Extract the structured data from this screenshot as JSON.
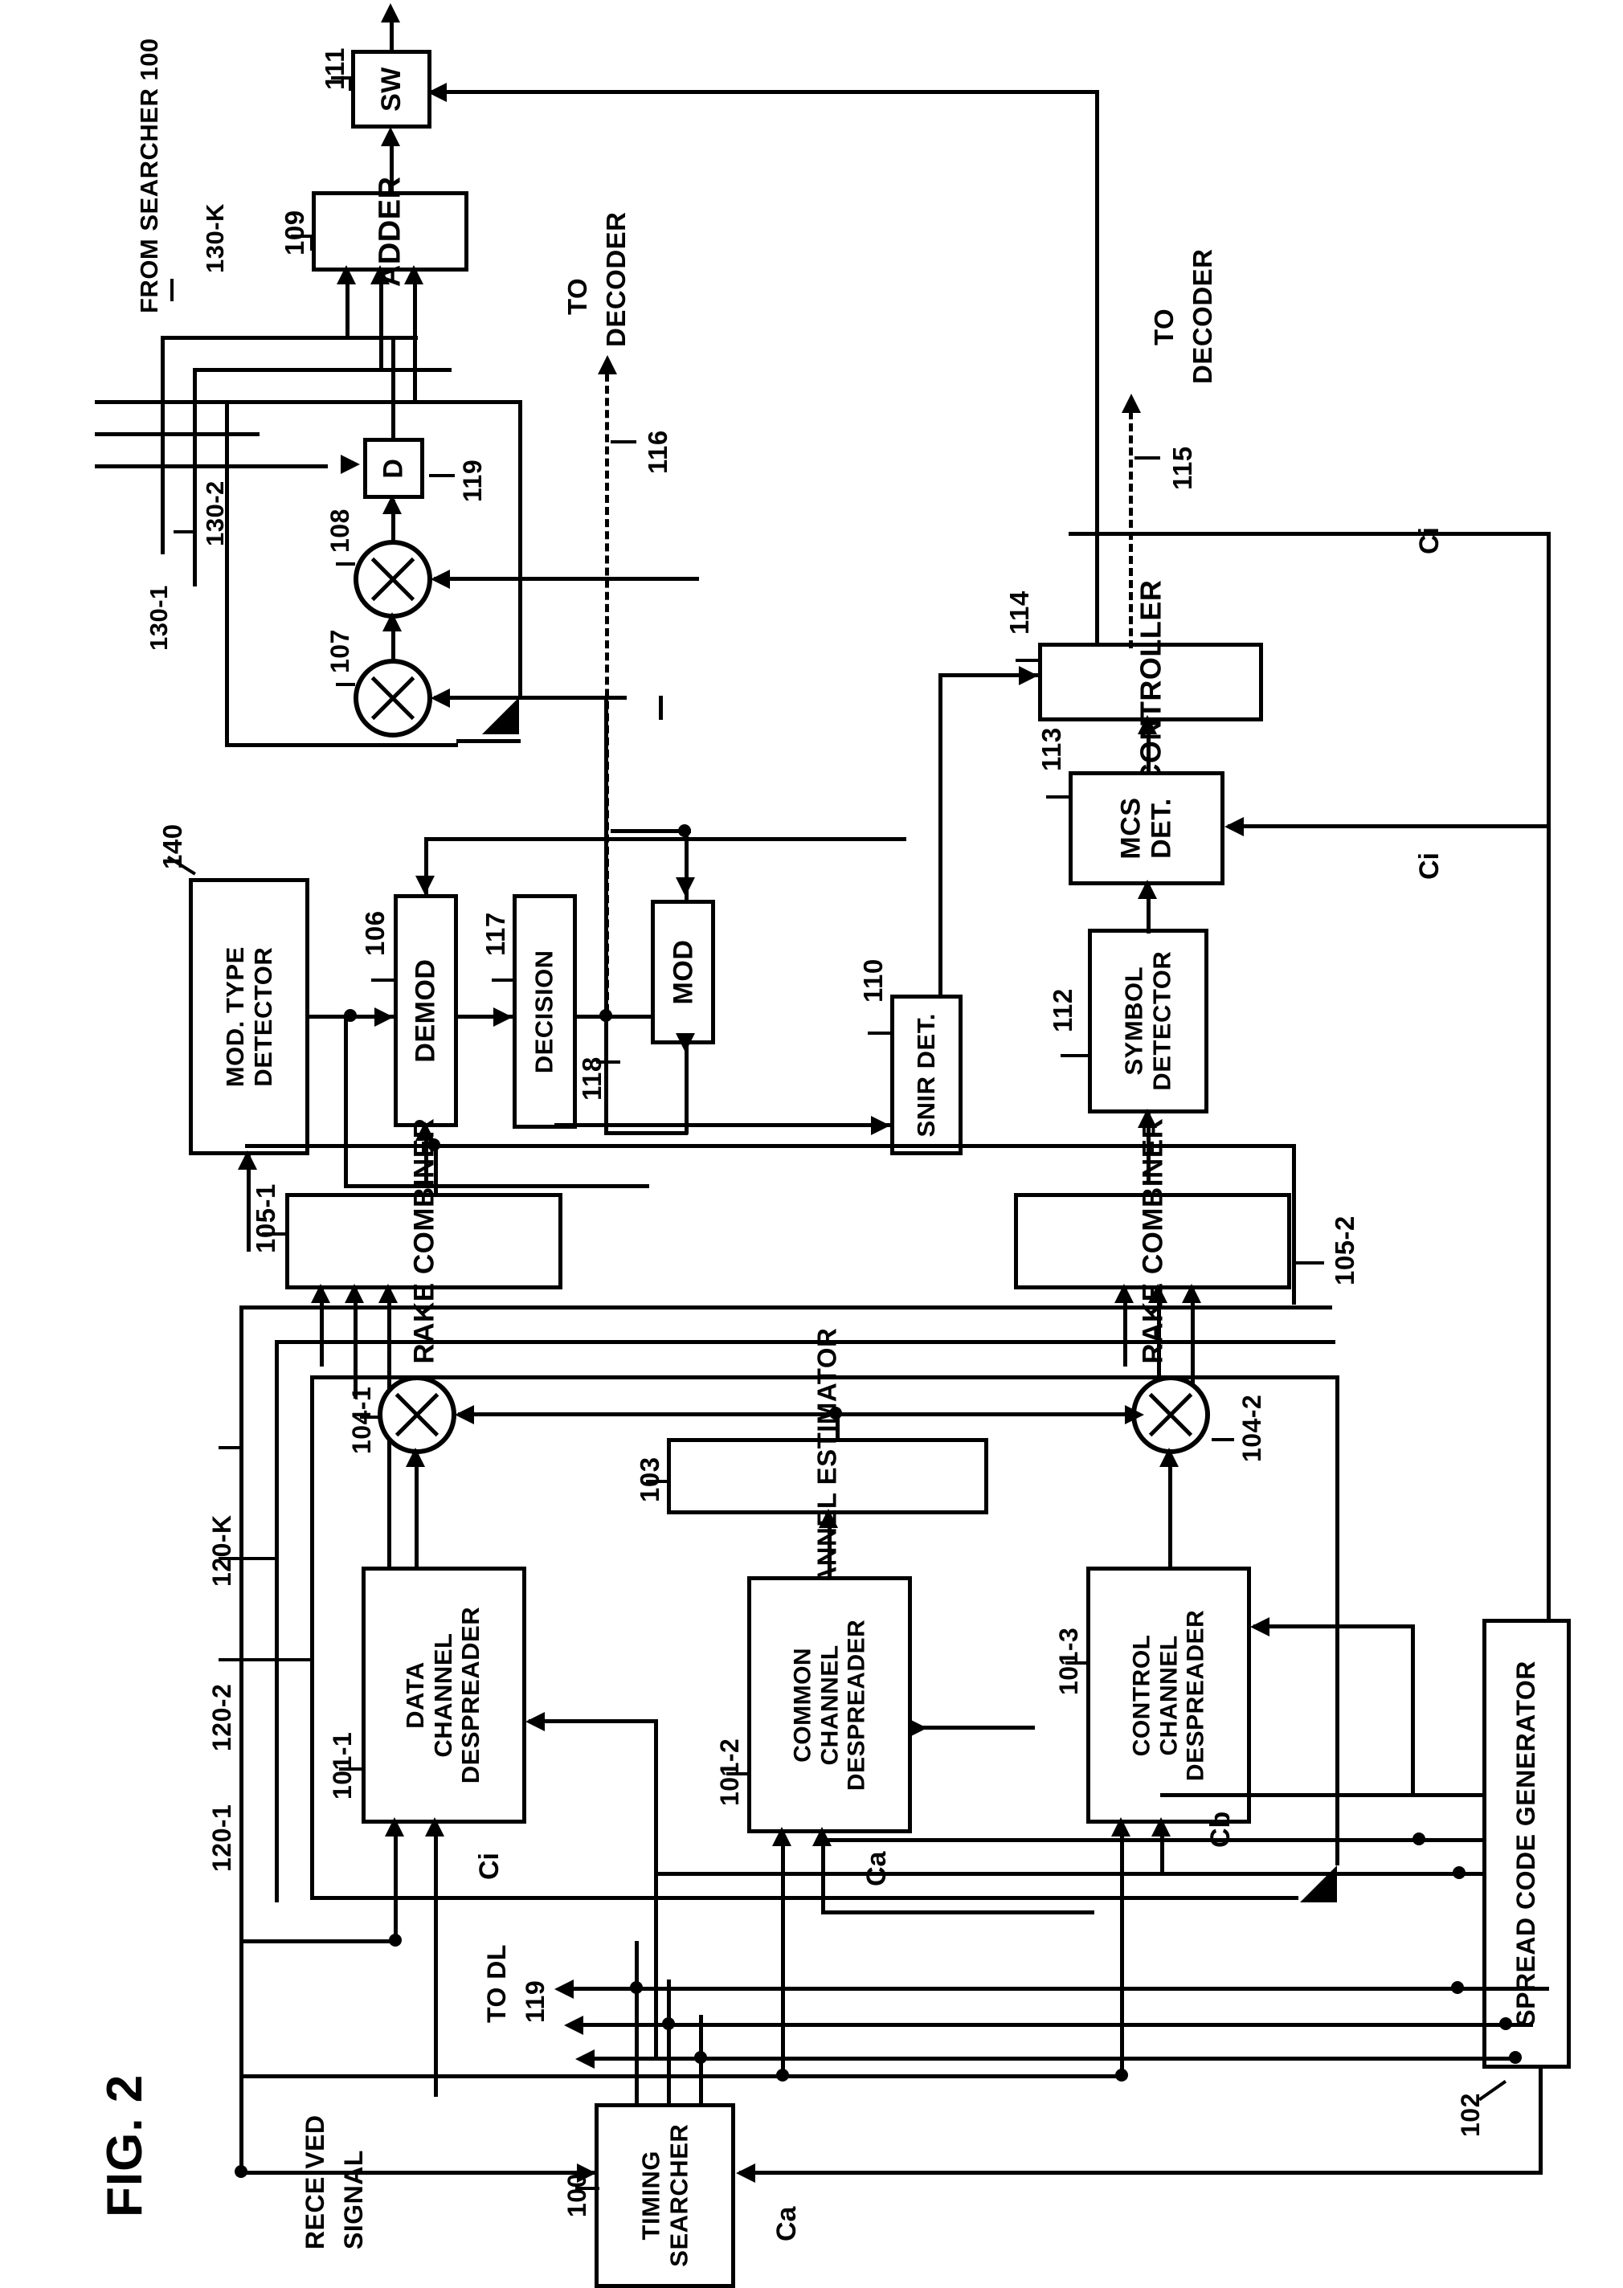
{
  "figure": {
    "title": "FIG. 2",
    "domain_note": "Patent block diagram of a CDMA rake receiver, drawn rotated 90 degrees"
  },
  "external_labels": {
    "from_searcher": "FROM SEARCHER 100",
    "received_signal": "RECEIVED\nSIGNAL",
    "received_signal_line1": "RECEIVED",
    "received_signal_line2": "SIGNAL",
    "to_decoder_top_line1": "TO",
    "to_decoder_top_line2": "DECODER",
    "to_decoder_mid_line1": "TO",
    "to_decoder_mid_line2": "DECODER",
    "to_dl_line1": "TO DL",
    "to_dl_line2": "119"
  },
  "blocks": [
    {
      "id": "sw",
      "ref": "111",
      "label": "SW"
    },
    {
      "id": "adder",
      "ref": "109",
      "label": "ADDER"
    },
    {
      "id": "delay",
      "ref": "119",
      "label": "D"
    },
    {
      "id": "controller",
      "ref": "114",
      "label": "CONTROLLER"
    },
    {
      "id": "mcs_det",
      "ref": "113",
      "label": "MCS\nDET.",
      "line1": "MCS",
      "line2": "DET."
    },
    {
      "id": "mod_type",
      "ref": "140",
      "label": "MOD. TYPE\nDETECTOR",
      "line1": "MOD. TYPE",
      "line2": "DETECTOR"
    },
    {
      "id": "demod",
      "ref": "106",
      "label": "DEMOD"
    },
    {
      "id": "decision",
      "ref": "117",
      "label": "DECISION"
    },
    {
      "id": "mod",
      "ref": "",
      "label": "MOD"
    },
    {
      "id": "snir_det",
      "ref": "110",
      "label": "SNIR DET."
    },
    {
      "id": "symbol_det",
      "ref": "112",
      "label": "SYMBOL\nDETECTOR",
      "line1": "SYMBOL",
      "line2": "DETECTOR"
    },
    {
      "id": "rake1",
      "ref": "105-1",
      "label": "RAKE COMBINER"
    },
    {
      "id": "rake2",
      "ref": "105-2",
      "label": "RAKE COMBINER"
    },
    {
      "id": "chan_est",
      "ref": "103",
      "label": "CHANNEL ESTIMATOR"
    },
    {
      "id": "data_desp",
      "ref": "101-1",
      "label": "DATA\nCHANNEL\nDESPREADER",
      "line1": "DATA",
      "line2": "CHANNEL",
      "line3": "DESPREADER"
    },
    {
      "id": "common_desp",
      "ref": "101-2",
      "label": "COMMON\nCHANNEL\nDESPREADER",
      "line1": "COMMON",
      "line2": "CHANNEL",
      "line3": "DESPREADER"
    },
    {
      "id": "ctrl_desp",
      "ref": "101-3",
      "label": "CONTROL\nCHANNEL\nDESPREADER",
      "line1": "CONTROL",
      "line2": "CHANNEL",
      "line3": "DESPREADER"
    },
    {
      "id": "spread_gen",
      "ref": "102",
      "label": "SPREAD CODE GENERATOR"
    },
    {
      "id": "timing",
      "ref": "100",
      "label": "TIMING\nSEARCHER",
      "line1": "TIMING",
      "line2": "SEARCHER"
    }
  ],
  "reference_numerals": {
    "sw": "111",
    "adder": "109",
    "delay": "119",
    "mult_107": "107",
    "mult_108": "108",
    "finger_130_1": "130-1",
    "finger_130_2": "130-2",
    "finger_130_k": "130-K",
    "decoder_path_116": "116",
    "decoder_path_115": "115",
    "controller": "114",
    "mcs_det": "113",
    "symbol_det": "112",
    "snir_det": "110",
    "mod_type_det": "140",
    "demod": "106",
    "decision": "117",
    "mod_path_118": "118",
    "rake_1": "105-1",
    "rake_2": "105-2",
    "mult_104_1": "104-1",
    "mult_104_2": "104-2",
    "chan_est": "103",
    "data_despreader": "101-1",
    "common_despreader": "101-2",
    "control_despreader": "101-3",
    "finger_120_1": "120-1",
    "finger_120_2": "120-2",
    "finger_120_k": "120-K",
    "spread_code_gen": "102",
    "timing_searcher": "100"
  },
  "signal_labels": {
    "ci_top": "Ci",
    "ci_mid": "Ci",
    "ci_despreader": "Ci",
    "ca_common": "Ca",
    "cb_control": "Cb",
    "ca_timing": "Ca"
  }
}
